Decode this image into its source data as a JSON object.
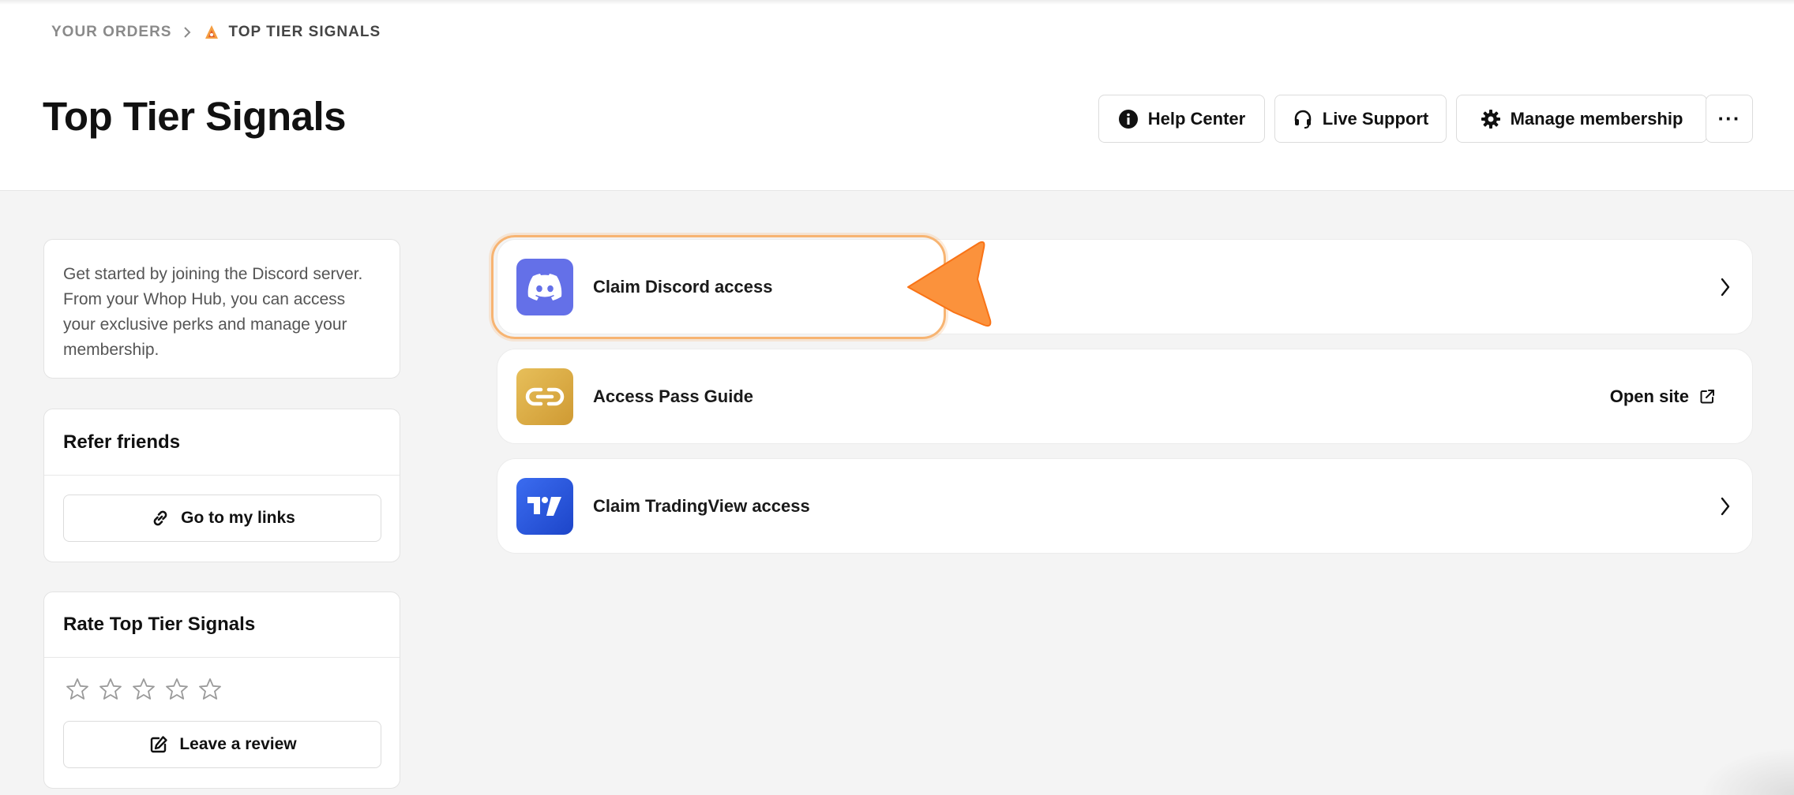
{
  "breadcrumb": {
    "parent": "YOUR ORDERS",
    "separator": ">",
    "current": "TOP TIER SIGNALS",
    "logo_icon": "flame-logo-icon"
  },
  "header": {
    "title": "Top Tier Signals",
    "buttons": {
      "help": {
        "label": "Help Center",
        "icon": "info-icon"
      },
      "live": {
        "label": "Live Support",
        "icon": "headset-icon"
      },
      "manage": {
        "label": "Manage membership",
        "icon": "gear-icon"
      },
      "more": {
        "label": "···",
        "icon": "ellipsis-icon"
      }
    }
  },
  "sidebar": {
    "intro": "Get started by joining the Discord server. From your Whop Hub, you can access your exclusive perks and manage your membership.",
    "refer": {
      "title": "Refer friends",
      "button_label": "Go to my links",
      "icon": "link-icon"
    },
    "rate": {
      "title": "Rate Top Tier Signals",
      "stars_total": 5,
      "stars_filled": 0,
      "button_label": "Leave a review",
      "icon": "edit-icon"
    }
  },
  "main": {
    "items": [
      {
        "label": "Claim Discord access",
        "icon": "discord-icon",
        "icon_color": "#6470e8",
        "action": "chevron-right-icon"
      },
      {
        "label": "Access Pass Guide",
        "icon": "link-icon",
        "icon_color": "#d9a63f",
        "action_label": "Open site",
        "action": "external-link-icon"
      },
      {
        "label": "Claim TradingView access",
        "icon": "tradingview-icon",
        "icon_color": "#2d5be3",
        "action": "chevron-right-icon"
      }
    ],
    "highlight_color": "#f7b472",
    "pointer_color": "#fb923c"
  }
}
